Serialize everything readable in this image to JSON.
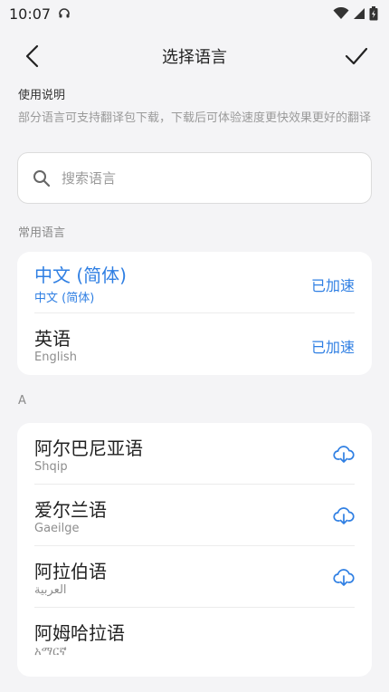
{
  "status_bar": {
    "time": "10:07",
    "icons": [
      "headset-icon",
      "wifi-icon",
      "cellular-icon",
      "battery-icon"
    ]
  },
  "header": {
    "title": "选择语言",
    "back_icon": "chevron-left-icon",
    "confirm_icon": "checkmark-icon"
  },
  "usage": {
    "title": "使用说明",
    "description": "部分语言可支持翻译包下载，下载后可体验速度更快效果更好的翻译"
  },
  "search": {
    "placeholder": "搜索语言",
    "icon": "search-icon"
  },
  "common_section": {
    "label": "常用语言",
    "items": [
      {
        "name": "中文 (简体)",
        "native": "中文 (简体)",
        "status": "已加速",
        "selected": true
      },
      {
        "name": "英语",
        "native": "English",
        "status": "已加速",
        "selected": false
      }
    ]
  },
  "section_a": {
    "label": "A",
    "items": [
      {
        "name": "阿尔巴尼亚语",
        "native": "Shqip",
        "action_icon": "cloud-download-icon"
      },
      {
        "name": "爱尔兰语",
        "native": "Gaeilge",
        "action_icon": "cloud-download-icon"
      },
      {
        "name": "阿拉伯语",
        "native": "العربية",
        "action_icon": "cloud-download-icon"
      },
      {
        "name": "阿姆哈拉语",
        "native": "አማርኛ",
        "action_icon": ""
      }
    ]
  },
  "colors": {
    "accent": "#2f7fe3",
    "background": "#f4f4f6",
    "card": "#ffffff",
    "secondary_text": "#8e8e8e"
  }
}
